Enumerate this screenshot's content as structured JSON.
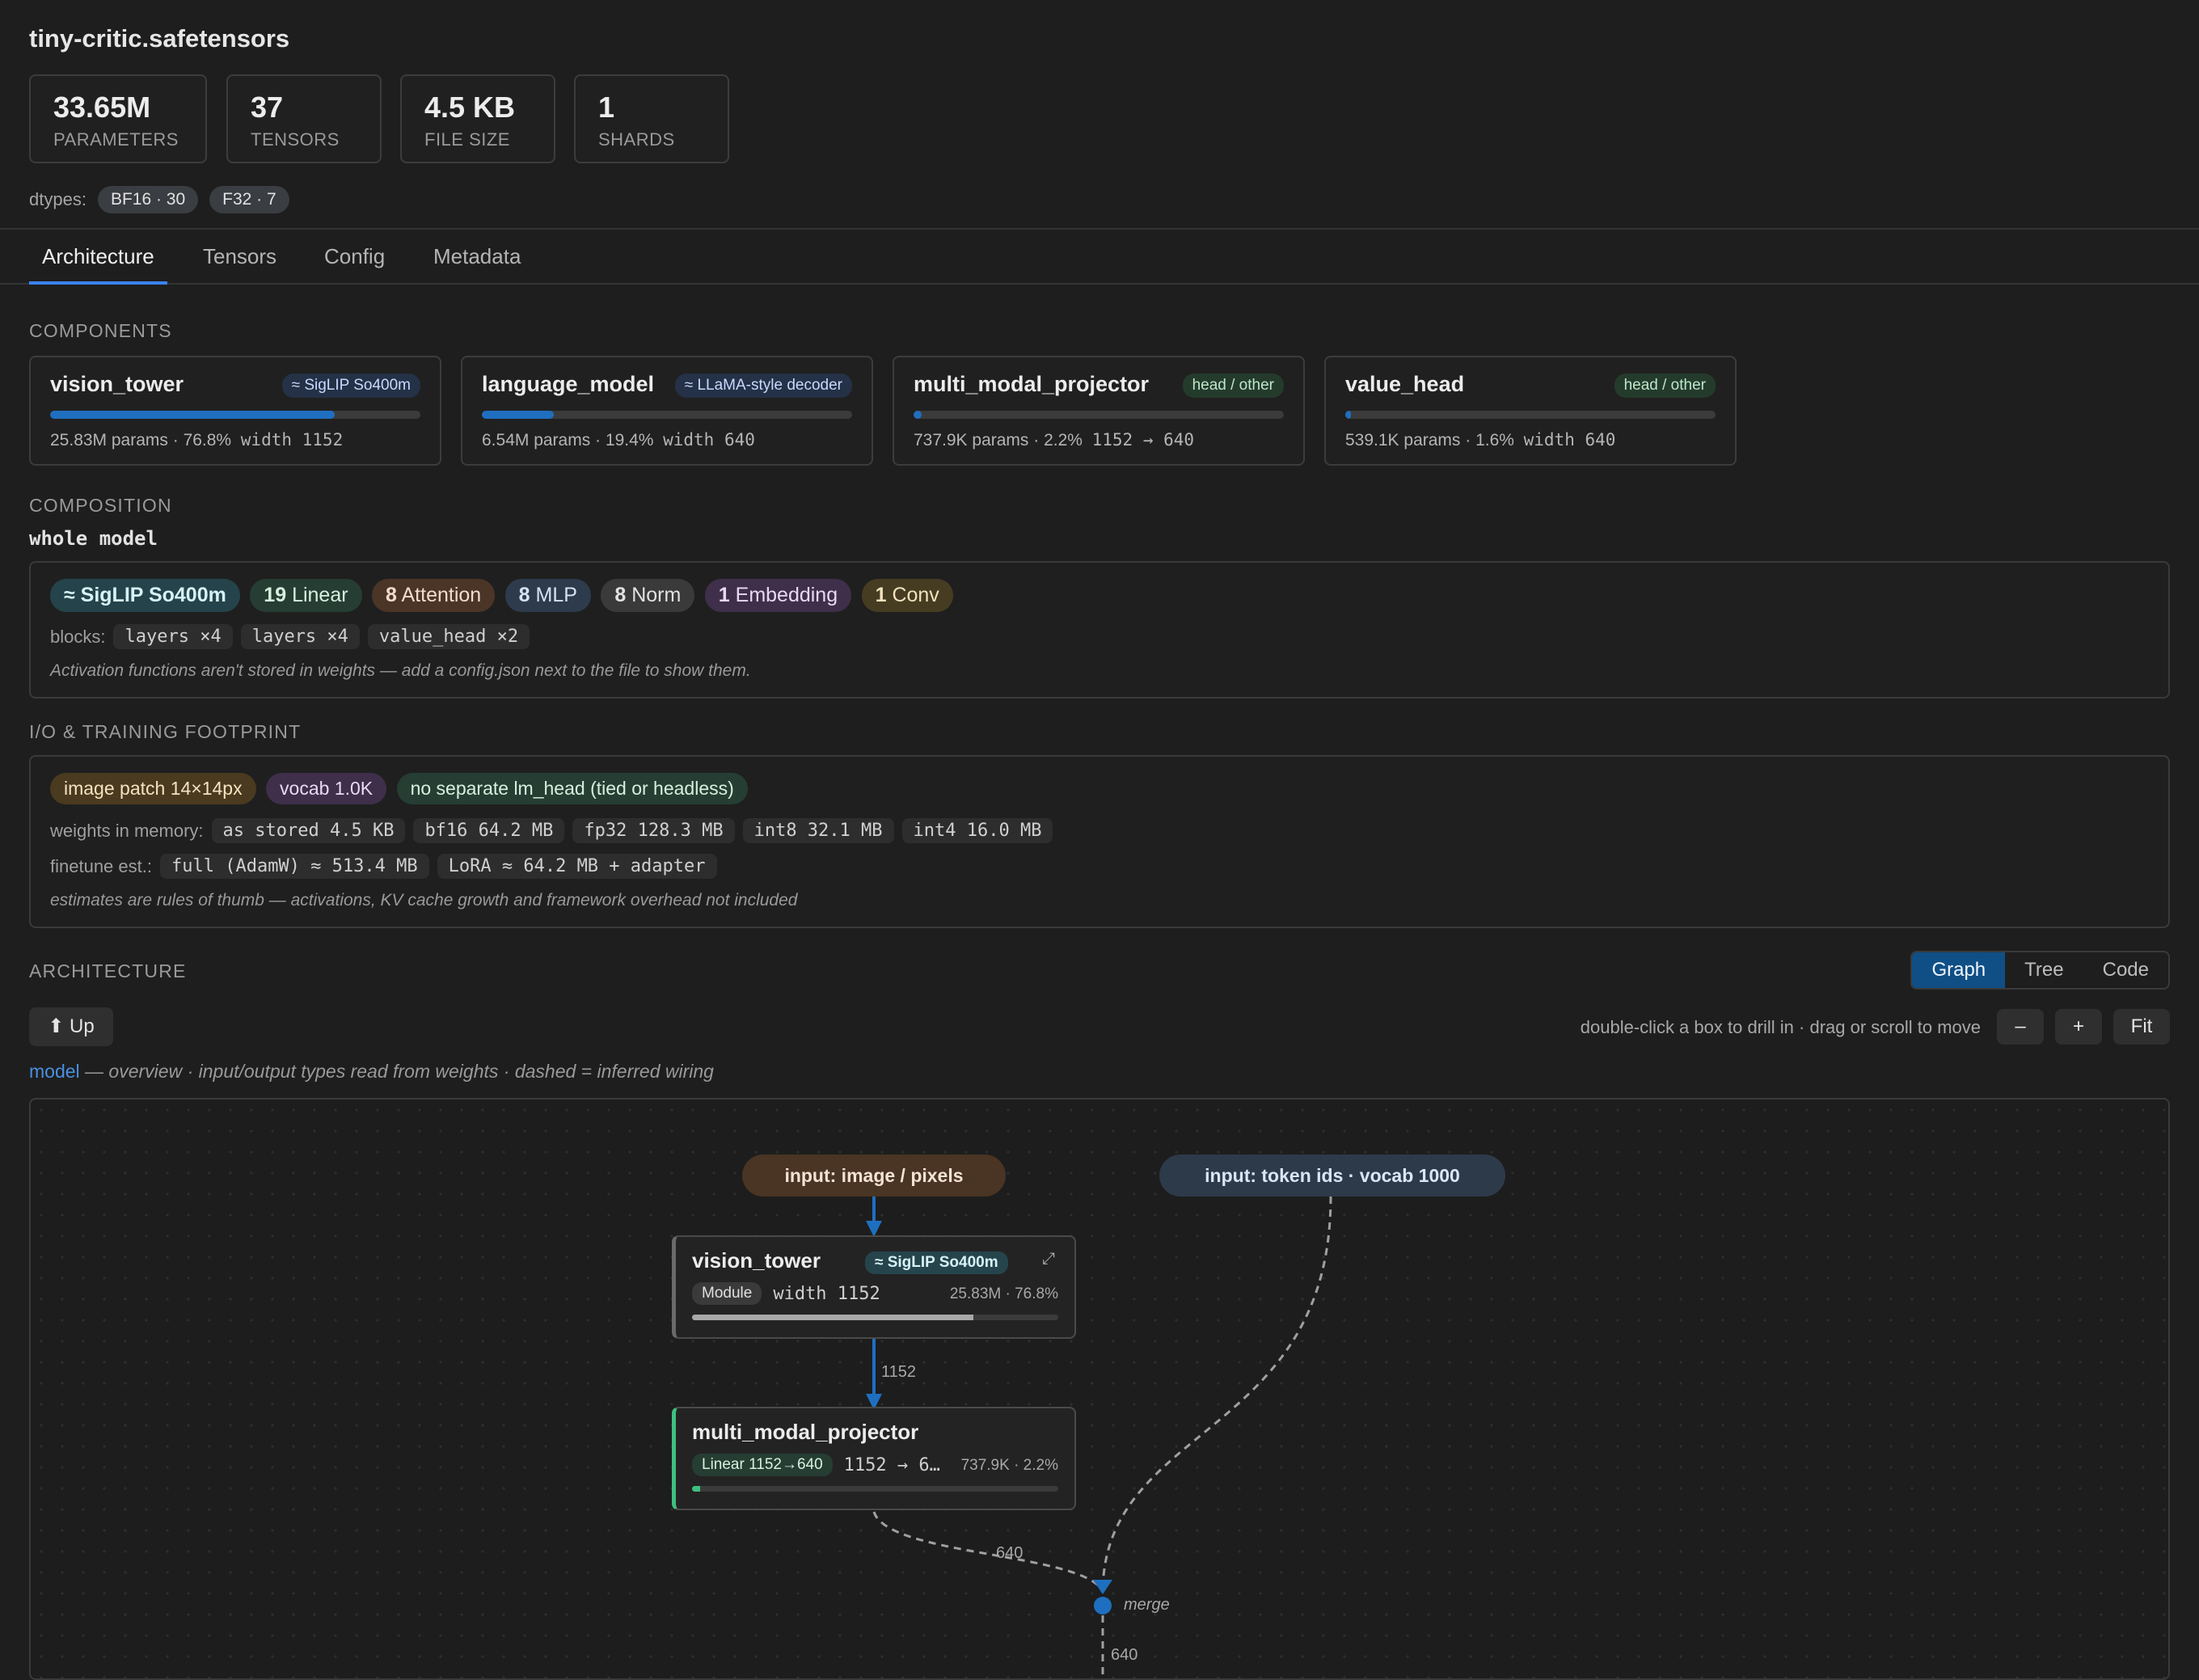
{
  "file": {
    "title": "tiny-critic.safetensors"
  },
  "stats": [
    {
      "value": "33.65M",
      "label": "PARAMETERS"
    },
    {
      "value": "37",
      "label": "TENSORS"
    },
    {
      "value": "4.5 KB",
      "label": "FILE SIZE"
    },
    {
      "value": "1",
      "label": "SHARDS"
    }
  ],
  "dtypes": {
    "label": "dtypes:",
    "items": [
      "BF16 · 30",
      "F32 · 7"
    ]
  },
  "tabs": [
    "Architecture",
    "Tensors",
    "Config",
    "Metadata"
  ],
  "components": {
    "heading": "COMPONENTS",
    "items": [
      {
        "name": "vision_tower",
        "badge": "≈ SigLIP So400m",
        "share": 0.768,
        "params": "25.83M params · 76.8%",
        "detail": "width 1152"
      },
      {
        "name": "language_model",
        "badge": "≈ LLaMA-style decoder",
        "share": 0.194,
        "params": "6.54M params · 19.4%",
        "detail": "width 640"
      },
      {
        "name": "multi_modal_projector",
        "badge": "head / other",
        "share": 0.022,
        "params": "737.9K params · 2.2%",
        "detail": "1152 → 640"
      },
      {
        "name": "value_head",
        "badge": "head / other",
        "share": 0.016,
        "params": "539.1K params · 1.6%",
        "detail": "width 640"
      }
    ]
  },
  "composition": {
    "heading": "COMPOSITION",
    "subheading": "whole model",
    "chips": {
      "siglip": "≈ SigLIP So400m",
      "linear_n": "19",
      "linear": "Linear",
      "attention_n": "8",
      "attention": "Attention",
      "mlp_n": "8",
      "mlp": "MLP",
      "norm_n": "8",
      "norm": "Norm",
      "embedding_n": "1",
      "embedding": "Embedding",
      "conv_n": "1",
      "conv": "Conv"
    },
    "blocks_label": "blocks:",
    "blocks": [
      "layers ×4",
      "layers ×4",
      "value_head ×2"
    ],
    "note": "Activation functions aren't stored in weights — add a config.json next to the file to show them."
  },
  "io": {
    "heading": "I/O & TRAINING FOOTPRINT",
    "chips": [
      "image patch 14×14px",
      "vocab 1.0K",
      "no separate lm_head (tied or headless)"
    ],
    "memory_label": "weights in memory:",
    "memory": [
      "as stored 4.5 KB",
      "bf16 64.2 MB",
      "fp32 128.3 MB",
      "int8 32.1 MB",
      "int4 16.0 MB"
    ],
    "finetune_label": "finetune est.:",
    "finetune": [
      "full (AdamW) ≈ 513.4 MB",
      "LoRA ≈ 64.2 MB + adapter"
    ],
    "note": "estimates are rules of thumb — activations, KV cache growth and framework overhead not included"
  },
  "architecture": {
    "heading": "ARCHITECTURE",
    "views": [
      "Graph",
      "Tree",
      "Code"
    ],
    "up_label": "⬆ Up",
    "hint": "double-click a box to drill in · drag or scroll to move",
    "zoom_out": "–",
    "zoom_in": "+",
    "fit": "Fit",
    "breadcrumb_link": "model",
    "breadcrumb_note": "— overview · input/output types read from weights · dashed = inferred wiring"
  },
  "graph": {
    "input_image": "input: image / pixels",
    "input_tokens": "input: token ids · vocab 1000",
    "vision": {
      "name": "vision_tower",
      "badge": "≈ SigLIP So400m",
      "expand": "⤢",
      "type": "Module",
      "detail": "width 1152",
      "params": "25.83M · 76.8%",
      "share": 0.768
    },
    "projector": {
      "name": "multi_modal_projector",
      "type": "Linear 1152→640",
      "detail": "1152 → 6…",
      "params": "737.9K · 2.2%",
      "share": 0.022
    },
    "edge_vision_projector": "1152",
    "edge_projector_merge": "640",
    "merge_label": "merge",
    "edge_merge_out": "640"
  },
  "colors": {
    "accent": "#3b82f6",
    "graph_edge": "#1f6fc0",
    "projector_accent": "#3fbf7f"
  }
}
